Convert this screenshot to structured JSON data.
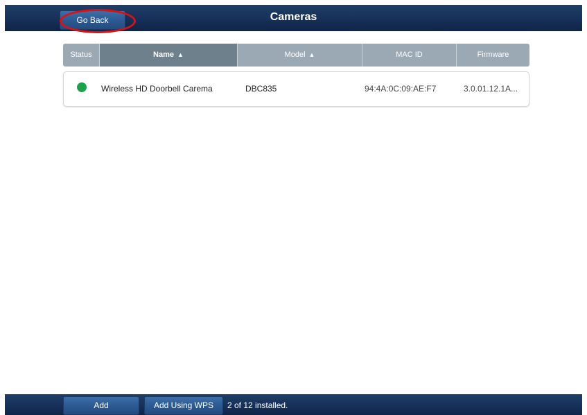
{
  "header": {
    "back_label": "Go Back",
    "title": "Cameras"
  },
  "table": {
    "columns": [
      {
        "label": "Status"
      },
      {
        "label": "Name",
        "sort_icon": "▲▼",
        "sorted": true
      },
      {
        "label": "Model",
        "sort_icon": "▲▼"
      },
      {
        "label": "MAC ID"
      },
      {
        "label": "Firmware"
      }
    ],
    "rows": [
      {
        "status_color": "#1aa34a",
        "name": "Wireless HD Doorbell Carema",
        "model": "DBC835",
        "mac_id": "94:4A:0C:09:AE:F7",
        "firmware": "3.0.01.12.1A..."
      }
    ]
  },
  "footer": {
    "add_label": "Add",
    "add_wps_label": "Add Using WPS",
    "installed_text": "2 of 12 installed."
  },
  "colors": {
    "bar": "#16305a",
    "highlight_ring": "#e01010",
    "status_online": "#1aa34a"
  }
}
